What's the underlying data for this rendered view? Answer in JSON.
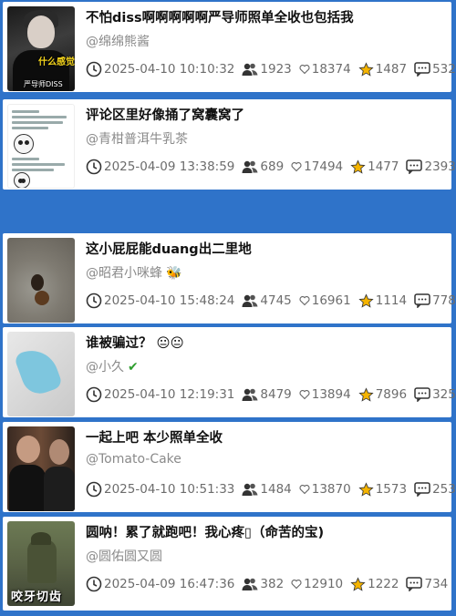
{
  "items": [
    {
      "title": "不怕diss啊啊啊啊啊严导师照单全收也包括我",
      "author": "@绵绵熊酱",
      "badge": "",
      "date": "2025-04-10 10:10:32",
      "followers": "1923",
      "likes": "18374",
      "stars": "1487",
      "comments": "532",
      "thumb_caption_1": "什么感觉",
      "thumb_caption_2": "严导师DISS"
    },
    {
      "title": "评论区里好像捅了窝囊窝了",
      "author": "@青柑普洱牛乳茶",
      "badge": "",
      "date": "2025-04-09 13:38:59",
      "followers": "689",
      "likes": "17494",
      "stars": "1477",
      "comments": "2393"
    },
    {
      "title": "这小屁屁能duang出二里地",
      "author": "@昭君小咪蜂",
      "badge": "🐝",
      "date": "2025-04-10 15:48:24",
      "followers": "4745",
      "likes": "16961",
      "stars": "1114",
      "comments": "778"
    },
    {
      "title": "谁被骗过？ 😐😐",
      "author": "@小久",
      "badge": "✔",
      "date": "2025-04-10 12:19:31",
      "followers": "8479",
      "likes": "13894",
      "stars": "7896",
      "comments": "325"
    },
    {
      "title": "一起上吧 本少照单全收",
      "author": "@Tomato-Cake",
      "badge": "",
      "date": "2025-04-10 10:51:33",
      "followers": "1484",
      "likes": "13870",
      "stars": "1573",
      "comments": "253"
    },
    {
      "title": "圆呐！累了就跑吧！我心疼▯（命苦的宝)",
      "author": "@圆佑圆又圆",
      "badge": "",
      "date": "2025-04-09 16:47:36",
      "followers": "382",
      "likes": "12910",
      "stars": "1222",
      "comments": "734",
      "thumb_caption_1": "咬牙切齿"
    }
  ],
  "colors": {
    "background": "#2f73c9",
    "card": "#ffffff",
    "star": "#f5b400",
    "check": "#2e9e2e"
  }
}
